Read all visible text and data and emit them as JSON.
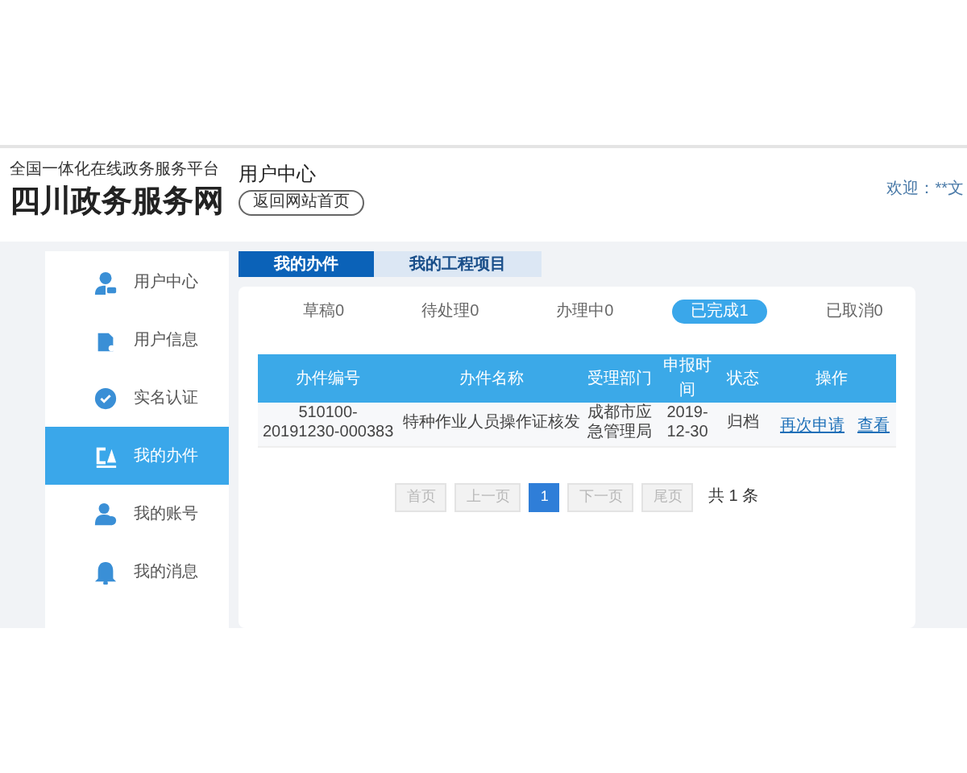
{
  "header": {
    "slogan": "全国一体化在线政务服务平台",
    "site_title": "四川政务服务网",
    "page_title": "用户中心",
    "back_button": "返回网站首页",
    "welcome": "欢迎：**文"
  },
  "sidebar": {
    "items": [
      {
        "label": "用户中心",
        "selected": false
      },
      {
        "label": "用户信息",
        "selected": false
      },
      {
        "label": "实名认证",
        "selected": false
      },
      {
        "label": "我的办件",
        "selected": true
      },
      {
        "label": "我的账号",
        "selected": false
      },
      {
        "label": "我的消息",
        "selected": false
      }
    ]
  },
  "tabs": [
    {
      "label": "我的办件",
      "selected": true
    },
    {
      "label": "我的工程项目",
      "selected": false
    }
  ],
  "filters": [
    {
      "label": "草稿0",
      "selected": false
    },
    {
      "label": "待处理0",
      "selected": false
    },
    {
      "label": "办理中0",
      "selected": false
    },
    {
      "label": "已完成1",
      "selected": true
    },
    {
      "label": "已取消0",
      "selected": false
    }
  ],
  "table": {
    "columns": [
      "办件编号",
      "办件名称",
      "受理部门",
      "申报时间",
      "状态",
      "操作"
    ],
    "rows": [
      {
        "cells": [
          "510100-20191230-000383",
          "特种作业人员操作证核发",
          "成都市应急管理局",
          "2019-12-30",
          "归档"
        ],
        "actions": [
          "再次申请",
          "查看"
        ]
      }
    ]
  },
  "pagination": {
    "buttons": [
      {
        "label": "首页",
        "selected": false
      },
      {
        "label": "上一页",
        "selected": false
      },
      {
        "label": "1",
        "selected": true
      },
      {
        "label": "下一页",
        "selected": false
      },
      {
        "label": "尾页",
        "selected": false
      }
    ],
    "total": "共 1 条"
  }
}
